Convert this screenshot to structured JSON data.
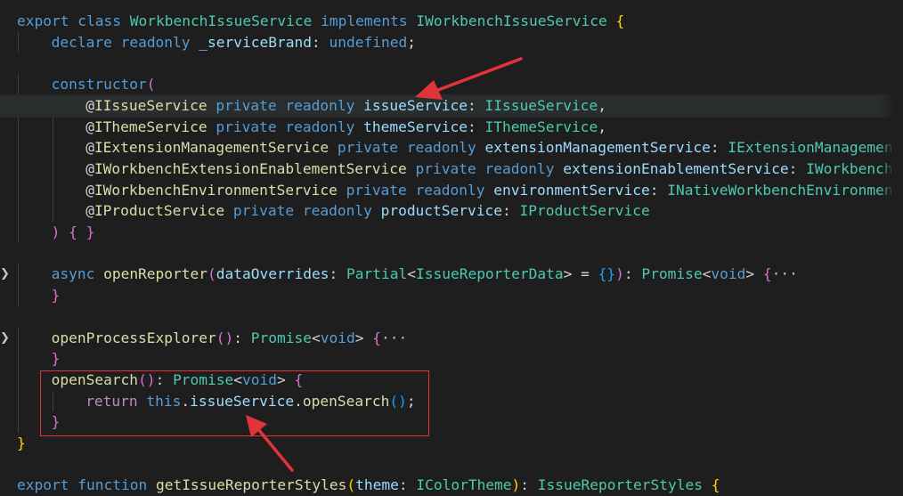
{
  "code_lines": [
    {
      "indent": 0,
      "tokens": [
        {
          "c": "kw",
          "t": "export"
        },
        {
          "c": "pu",
          "t": " "
        },
        {
          "c": "kw",
          "t": "class"
        },
        {
          "c": "pu",
          "t": " "
        },
        {
          "c": "ty",
          "t": "WorkbenchIssueService"
        },
        {
          "c": "pu",
          "t": " "
        },
        {
          "c": "kw",
          "t": "implements"
        },
        {
          "c": "pu",
          "t": " "
        },
        {
          "c": "ty",
          "t": "IWorkbenchIssueService"
        },
        {
          "c": "pu",
          "t": " "
        },
        {
          "c": "br1",
          "t": "{"
        }
      ]
    },
    {
      "indent": 1,
      "tokens": [
        {
          "c": "kw",
          "t": "declare"
        },
        {
          "c": "pu",
          "t": " "
        },
        {
          "c": "kw",
          "t": "readonly"
        },
        {
          "c": "pu",
          "t": " "
        },
        {
          "c": "pm",
          "t": "_serviceBrand"
        },
        {
          "c": "pu",
          "t": ": "
        },
        {
          "c": "kw",
          "t": "undefined"
        },
        {
          "c": "pu",
          "t": ";"
        }
      ]
    },
    {
      "indent": 0,
      "tokens": []
    },
    {
      "indent": 1,
      "tokens": [
        {
          "c": "kw",
          "t": "constructor"
        },
        {
          "c": "br2",
          "t": "("
        }
      ]
    },
    {
      "indent": 2,
      "tokens": [
        {
          "c": "pu",
          "t": "@"
        },
        {
          "c": "fn",
          "t": "IIssueService"
        },
        {
          "c": "pu",
          "t": " "
        },
        {
          "c": "kw",
          "t": "private"
        },
        {
          "c": "pu",
          "t": " "
        },
        {
          "c": "kw",
          "t": "readonly"
        },
        {
          "c": "pu",
          "t": " "
        },
        {
          "c": "pm",
          "t": "issueService"
        },
        {
          "c": "pu",
          "t": ": "
        },
        {
          "c": "ty",
          "t": "IIssueService"
        },
        {
          "c": "pu",
          "t": ","
        }
      ]
    },
    {
      "indent": 2,
      "tokens": [
        {
          "c": "pu",
          "t": "@"
        },
        {
          "c": "fn",
          "t": "IThemeService"
        },
        {
          "c": "pu",
          "t": " "
        },
        {
          "c": "kw",
          "t": "private"
        },
        {
          "c": "pu",
          "t": " "
        },
        {
          "c": "kw",
          "t": "readonly"
        },
        {
          "c": "pu",
          "t": " "
        },
        {
          "c": "pm",
          "t": "themeService"
        },
        {
          "c": "pu",
          "t": ": "
        },
        {
          "c": "ty",
          "t": "IThemeService"
        },
        {
          "c": "pu",
          "t": ","
        }
      ]
    },
    {
      "indent": 2,
      "tokens": [
        {
          "c": "pu",
          "t": "@"
        },
        {
          "c": "fn",
          "t": "IExtensionManagementService"
        },
        {
          "c": "pu",
          "t": " "
        },
        {
          "c": "kw",
          "t": "private"
        },
        {
          "c": "pu",
          "t": " "
        },
        {
          "c": "kw",
          "t": "readonly"
        },
        {
          "c": "pu",
          "t": " "
        },
        {
          "c": "pm",
          "t": "extensionManagementService"
        },
        {
          "c": "pu",
          "t": ": "
        },
        {
          "c": "ty",
          "t": "IExtensionManagemen"
        }
      ]
    },
    {
      "indent": 2,
      "tokens": [
        {
          "c": "pu",
          "t": "@"
        },
        {
          "c": "fn",
          "t": "IWorkbenchExtensionEnablementService"
        },
        {
          "c": "pu",
          "t": " "
        },
        {
          "c": "kw",
          "t": "private"
        },
        {
          "c": "pu",
          "t": " "
        },
        {
          "c": "kw",
          "t": "readonly"
        },
        {
          "c": "pu",
          "t": " "
        },
        {
          "c": "pm",
          "t": "extensionEnablementService"
        },
        {
          "c": "pu",
          "t": ": "
        },
        {
          "c": "ty",
          "t": "IWorkbench"
        }
      ]
    },
    {
      "indent": 2,
      "tokens": [
        {
          "c": "pu",
          "t": "@"
        },
        {
          "c": "fn",
          "t": "IWorkbenchEnvironmentService"
        },
        {
          "c": "pu",
          "t": " "
        },
        {
          "c": "kw",
          "t": "private"
        },
        {
          "c": "pu",
          "t": " "
        },
        {
          "c": "kw",
          "t": "readonly"
        },
        {
          "c": "pu",
          "t": " "
        },
        {
          "c": "pm",
          "t": "environmentService"
        },
        {
          "c": "pu",
          "t": ": "
        },
        {
          "c": "ty",
          "t": "INativeWorkbenchEnvironmen"
        }
      ]
    },
    {
      "indent": 2,
      "tokens": [
        {
          "c": "pu",
          "t": "@"
        },
        {
          "c": "fn",
          "t": "IProductService"
        },
        {
          "c": "pu",
          "t": " "
        },
        {
          "c": "kw",
          "t": "private"
        },
        {
          "c": "pu",
          "t": " "
        },
        {
          "c": "kw",
          "t": "readonly"
        },
        {
          "c": "pu",
          "t": " "
        },
        {
          "c": "pm",
          "t": "productService"
        },
        {
          "c": "pu",
          "t": ": "
        },
        {
          "c": "ty",
          "t": "IProductService"
        }
      ]
    },
    {
      "indent": 1,
      "tokens": [
        {
          "c": "br2",
          "t": ")"
        },
        {
          "c": "pu",
          "t": " "
        },
        {
          "c": "br2",
          "t": "{"
        },
        {
          "c": "pu",
          "t": " "
        },
        {
          "c": "br2",
          "t": "}"
        }
      ]
    },
    {
      "indent": 0,
      "tokens": []
    },
    {
      "indent": 1,
      "fold": true,
      "tokens": [
        {
          "c": "kw",
          "t": "async"
        },
        {
          "c": "pu",
          "t": " "
        },
        {
          "c": "fn",
          "t": "openReporter"
        },
        {
          "c": "br2",
          "t": "("
        },
        {
          "c": "pm",
          "t": "dataOverrides"
        },
        {
          "c": "pu",
          "t": ": "
        },
        {
          "c": "ty",
          "t": "Partial"
        },
        {
          "c": "pu",
          "t": "<"
        },
        {
          "c": "ty",
          "t": "IssueReporterData"
        },
        {
          "c": "pu",
          "t": "> = "
        },
        {
          "c": "br3",
          "t": "{}"
        },
        {
          "c": "br2",
          "t": ")"
        },
        {
          "c": "pu",
          "t": ": "
        },
        {
          "c": "ty",
          "t": "Promise"
        },
        {
          "c": "pu",
          "t": "<"
        },
        {
          "c": "kw",
          "t": "void"
        },
        {
          "c": "pu",
          "t": "> "
        },
        {
          "c": "br2",
          "t": "{"
        },
        {
          "c": "ellip",
          "t": "···"
        }
      ]
    },
    {
      "indent": 1,
      "tokens": [
        {
          "c": "br2",
          "t": "}"
        }
      ]
    },
    {
      "indent": 0,
      "tokens": []
    },
    {
      "indent": 1,
      "fold": true,
      "tokens": [
        {
          "c": "fn",
          "t": "openProcessExplorer"
        },
        {
          "c": "br2",
          "t": "()"
        },
        {
          "c": "pu",
          "t": ": "
        },
        {
          "c": "ty",
          "t": "Promise"
        },
        {
          "c": "pu",
          "t": "<"
        },
        {
          "c": "kw",
          "t": "void"
        },
        {
          "c": "pu",
          "t": "> "
        },
        {
          "c": "br2",
          "t": "{"
        },
        {
          "c": "ellip",
          "t": "···"
        }
      ]
    },
    {
      "indent": 1,
      "tokens": [
        {
          "c": "br2",
          "t": "}"
        }
      ]
    },
    {
      "indent": 1,
      "tokens": [
        {
          "c": "fn",
          "t": "openSearch"
        },
        {
          "c": "br2",
          "t": "()"
        },
        {
          "c": "pu",
          "t": ": "
        },
        {
          "c": "ty",
          "t": "Promise"
        },
        {
          "c": "pu",
          "t": "<"
        },
        {
          "c": "kw",
          "t": "void"
        },
        {
          "c": "pu",
          "t": "> "
        },
        {
          "c": "br2",
          "t": "{"
        }
      ]
    },
    {
      "indent": 2,
      "tokens": [
        {
          "c": "ctl",
          "t": "return"
        },
        {
          "c": "pu",
          "t": " "
        },
        {
          "c": "kw",
          "t": "this"
        },
        {
          "c": "pu",
          "t": "."
        },
        {
          "c": "pm",
          "t": "issueService"
        },
        {
          "c": "pu",
          "t": "."
        },
        {
          "c": "fn",
          "t": "openSearch"
        },
        {
          "c": "br3",
          "t": "()"
        },
        {
          "c": "pu",
          "t": ";"
        }
      ]
    },
    {
      "indent": 1,
      "tokens": [
        {
          "c": "br2",
          "t": "}"
        }
      ]
    },
    {
      "indent": 0,
      "tokens": [
        {
          "c": "br1",
          "t": "}"
        }
      ]
    },
    {
      "indent": 0,
      "tokens": []
    },
    {
      "indent": 0,
      "tokens": [
        {
          "c": "kw",
          "t": "export"
        },
        {
          "c": "pu",
          "t": " "
        },
        {
          "c": "kw",
          "t": "function"
        },
        {
          "c": "pu",
          "t": " "
        },
        {
          "c": "fn",
          "t": "getIssueReporterStyles"
        },
        {
          "c": "br1",
          "t": "("
        },
        {
          "c": "pm",
          "t": "theme"
        },
        {
          "c": "pu",
          "t": ": "
        },
        {
          "c": "ty",
          "t": "IColorTheme"
        },
        {
          "c": "br1",
          "t": ")"
        },
        {
          "c": "pu",
          "t": ": "
        },
        {
          "c": "ty",
          "t": "IssueReporterStyles"
        },
        {
          "c": "pu",
          "t": " "
        },
        {
          "c": "br1",
          "t": "{"
        }
      ]
    }
  ],
  "highlight_lines": [
    4
  ],
  "folded_lines": [
    12,
    15
  ]
}
